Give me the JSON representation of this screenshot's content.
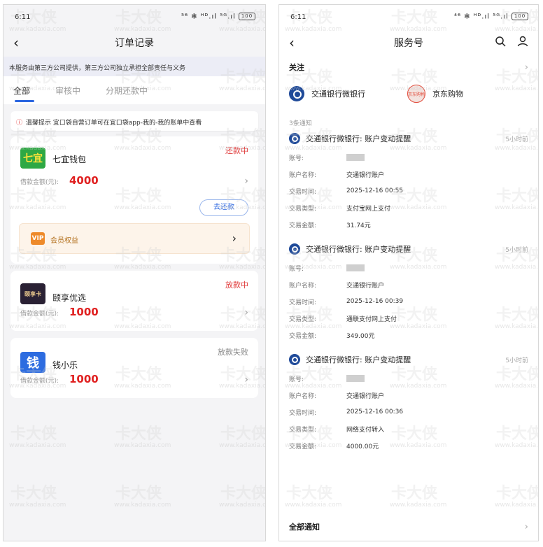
{
  "left": {
    "status": {
      "time": "6:11",
      "icons": "⁵⁶ ✻ ᴴᴰ.ıl ⁵ᴳ.ıl",
      "battery": "100"
    },
    "nav": {
      "back": "‹",
      "title": "订单记录"
    },
    "notice": "本服务由第三方公司提供，第三方公司独立承担全部责任与义务",
    "tabs": [
      {
        "label": "全部",
        "active": true
      },
      {
        "label": "审核中",
        "active": false
      },
      {
        "label": "分期还款中",
        "active": false
      }
    ],
    "tip": {
      "icon": "ⓘ",
      "text": "温馨提示 宜口袋自营订单可在宜口袋app-我的-我的账单中查看"
    },
    "cards": [
      {
        "logo": "七宜",
        "name": "七宜钱包",
        "status": "还款中",
        "status_color": "#e03a3a",
        "loan_label": "借款金额(元):",
        "amount": "4000",
        "repay_button": "去还款",
        "vip_icon": "VIP",
        "vip_label": "会员权益"
      },
      {
        "logo": "颐享卡",
        "name": "颐享优选",
        "status": "放款中",
        "status_color": "#e03a3a",
        "loan_label": "借款金额(元):",
        "amount": "1000"
      },
      {
        "logo": "钱",
        "name": "钱小乐",
        "status": "放款失败",
        "status_color": "#888888",
        "loan_label": "借款金额(元):",
        "amount": "1000"
      }
    ]
  },
  "right": {
    "status": {
      "time": "6:11",
      "icons": "⁴⁶ ✻ ᴴᴰ.ıl ⁵ᴳ.ıl",
      "battery": "100"
    },
    "nav": {
      "back": "‹",
      "title": "服务号"
    },
    "follow": {
      "title": "关注",
      "items": [
        {
          "name": "交通银行微银行"
        },
        {
          "name": "京东购物",
          "logo_text": "京东购物"
        }
      ]
    },
    "messages_title": "3条通知",
    "messages": [
      {
        "title": "交通银行微银行: 账户变动提醒",
        "time": "5小时前",
        "account_label": "账号:",
        "rows": [
          {
            "k": "账户名称:",
            "v": "交通银行账户"
          },
          {
            "k": "交易时间:",
            "v": "2025-12-16 00:55"
          },
          {
            "k": "交易类型:",
            "v": "支付宝网上支付"
          },
          {
            "k": "交易金额:",
            "v": "31.74元"
          }
        ]
      },
      {
        "title": "交通银行微银行: 账户变动提醒",
        "time": "5小时前",
        "account_label": "账号:",
        "rows": [
          {
            "k": "账户名称:",
            "v": "交通银行账户"
          },
          {
            "k": "交易时间:",
            "v": "2025-12-16 00:39"
          },
          {
            "k": "交易类型:",
            "v": "通联支付网上支付"
          },
          {
            "k": "交易金额:",
            "v": "349.00元"
          }
        ]
      },
      {
        "title": "交通银行微银行: 账户变动提醒",
        "time": "5小时前",
        "account_label": "账号:",
        "rows": [
          {
            "k": "账户名称:",
            "v": "交通银行账户"
          },
          {
            "k": "交易时间:",
            "v": "2025-12-16 00:36"
          },
          {
            "k": "交易类型:",
            "v": "网络支付转入"
          },
          {
            "k": "交易金额:",
            "v": "4000.00元"
          }
        ]
      }
    ],
    "all_notice": "全部通知"
  },
  "watermark": {
    "big": "卡大侠",
    "small": "www.kadaxia.com"
  }
}
